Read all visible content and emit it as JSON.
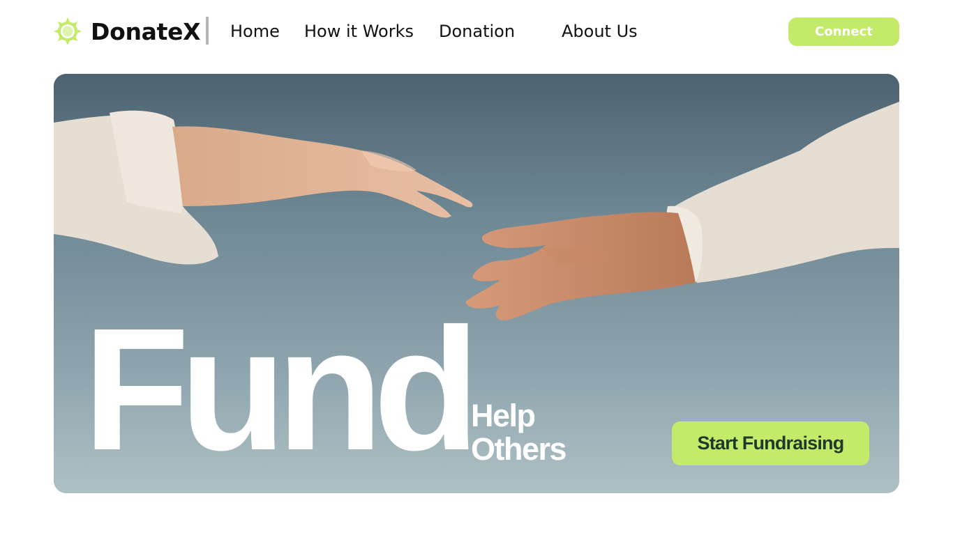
{
  "brand": {
    "name": "DonateX",
    "icon": "sun-gear-icon",
    "accent_color": "#c4ea6a"
  },
  "nav": {
    "items": [
      {
        "label": "Home"
      },
      {
        "label": "How it Works"
      },
      {
        "label": "Donation"
      },
      {
        "label": "About Us"
      }
    ]
  },
  "header": {
    "connect_label": "Connect"
  },
  "hero": {
    "headline": "Fund",
    "subline_1": "Help",
    "subline_2": "Others",
    "cta_label": "Start Fundraising",
    "cta_text_color": "#1d3a2c",
    "image": "two-hands-reaching-photo"
  }
}
